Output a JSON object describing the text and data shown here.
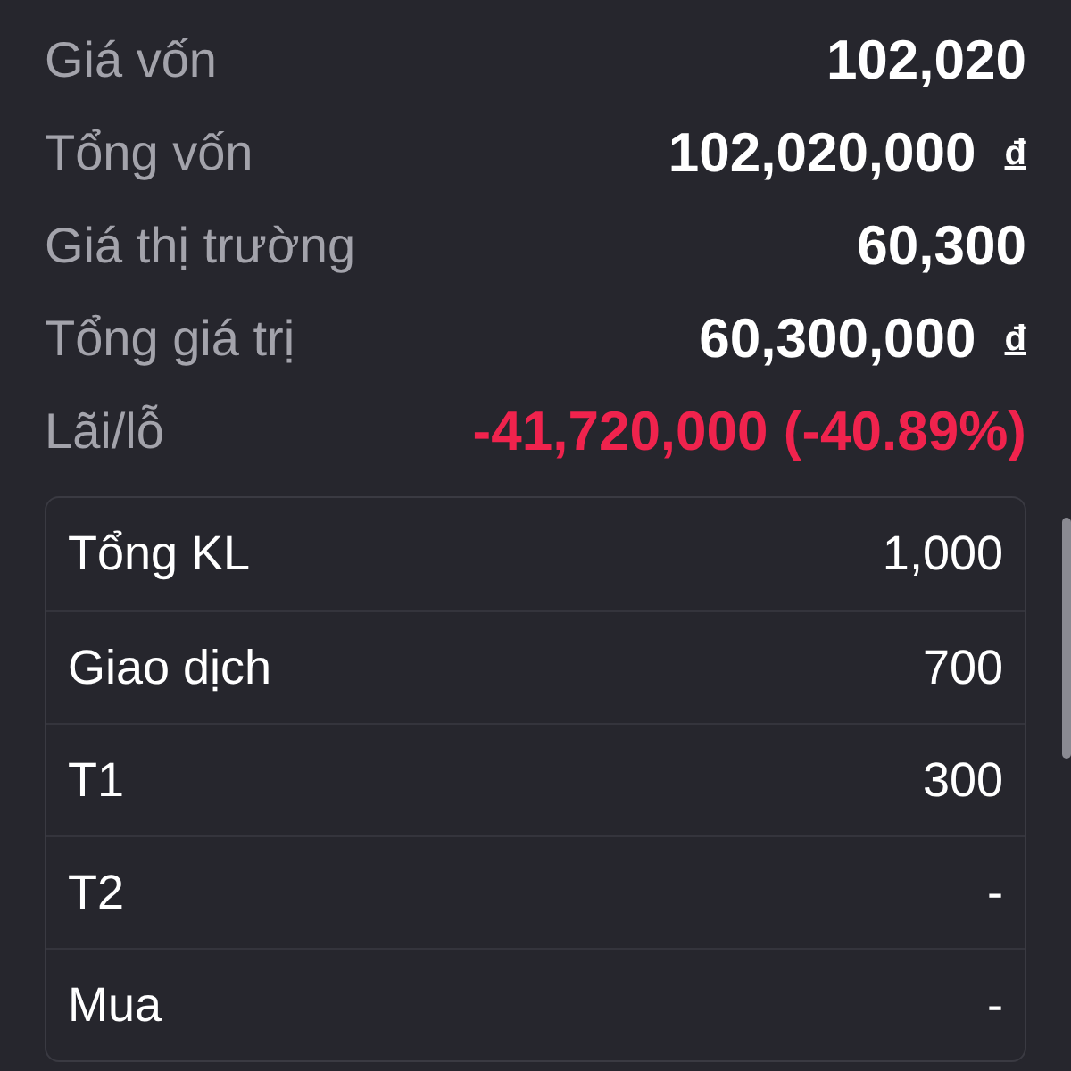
{
  "summary": [
    {
      "label": "Giá vốn",
      "value": "102,020",
      "kind": "plain"
    },
    {
      "label": "Tổng vốn",
      "value": "102,020,000",
      "unit": "đ",
      "kind": "plain"
    },
    {
      "label": "Giá thị trường",
      "value": "60,300",
      "kind": "plain"
    },
    {
      "label": "Tổng giá trị",
      "value": "60,300,000",
      "unit": "đ",
      "kind": "plain"
    },
    {
      "label": "Lãi/lỗ",
      "value": "-41,720,000 (-40.89%)",
      "kind": "negative"
    }
  ],
  "volume_table": {
    "rows": [
      {
        "label": "Tổng KL",
        "value": "1,000"
      },
      {
        "label": "Giao dịch",
        "value": "700"
      },
      {
        "label": "T1",
        "value": "300"
      },
      {
        "label": "T2",
        "value": "-"
      },
      {
        "label": "Mua",
        "value": "-"
      }
    ]
  }
}
